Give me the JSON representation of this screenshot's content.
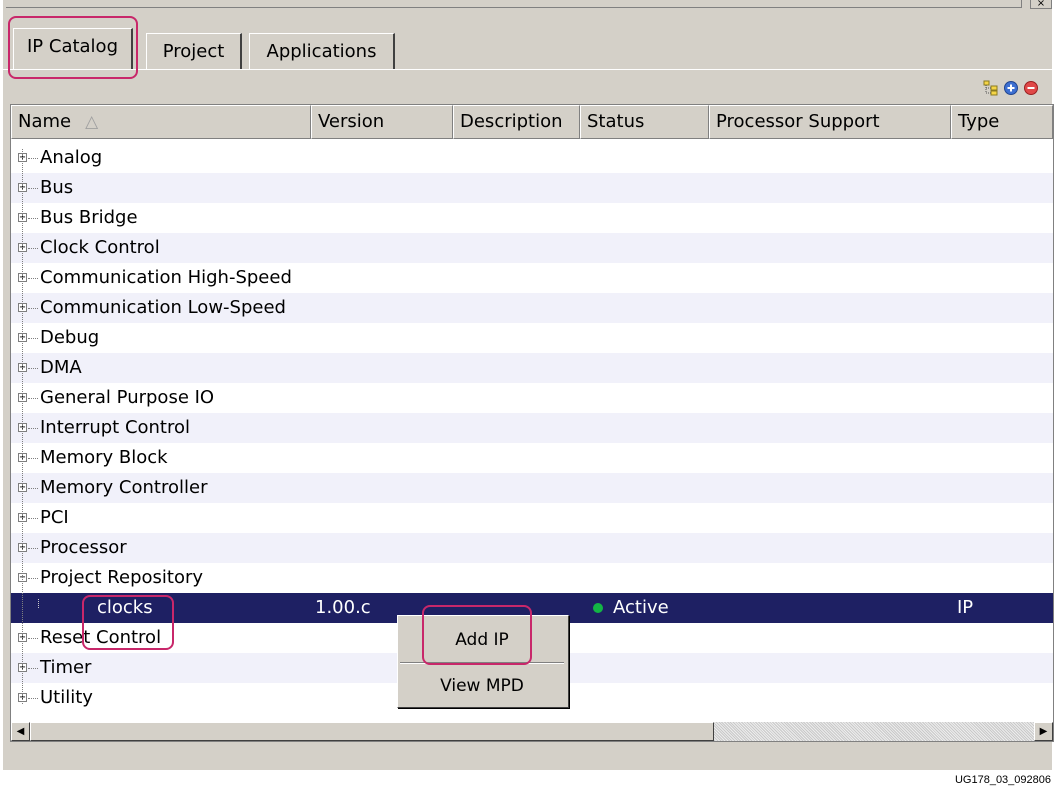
{
  "tabs": [
    {
      "label": "IP Catalog",
      "active": true
    },
    {
      "label": "Project",
      "active": false
    },
    {
      "label": "Applications",
      "active": false
    }
  ],
  "toolbar": {
    "icons": [
      "hierarchy-icon",
      "expand-all-icon",
      "collapse-all-icon"
    ]
  },
  "columns": [
    "Name",
    "Version",
    "Description",
    "Status",
    "Processor Support",
    "Type"
  ],
  "sort_indicator": "△",
  "rows": [
    {
      "name": "Analog",
      "expander": "+",
      "version": "",
      "status": "",
      "type": ""
    },
    {
      "name": "Bus",
      "expander": "+",
      "version": "",
      "status": "",
      "type": ""
    },
    {
      "name": "Bus Bridge",
      "expander": "+",
      "version": "",
      "status": "",
      "type": ""
    },
    {
      "name": "Clock Control",
      "expander": "+",
      "version": "",
      "status": "",
      "type": ""
    },
    {
      "name": "Communication High-Speed",
      "expander": "+",
      "version": "",
      "status": "",
      "type": ""
    },
    {
      "name": "Communication Low-Speed",
      "expander": "+",
      "version": "",
      "status": "",
      "type": ""
    },
    {
      "name": "Debug",
      "expander": "+",
      "version": "",
      "status": "",
      "type": ""
    },
    {
      "name": "DMA",
      "expander": "+",
      "version": "",
      "status": "",
      "type": ""
    },
    {
      "name": "General Purpose IO",
      "expander": "+",
      "version": "",
      "status": "",
      "type": ""
    },
    {
      "name": "Interrupt Control",
      "expander": "+",
      "version": "",
      "status": "",
      "type": ""
    },
    {
      "name": "Memory Block",
      "expander": "+",
      "version": "",
      "status": "",
      "type": ""
    },
    {
      "name": "Memory Controller",
      "expander": "+",
      "version": "",
      "status": "",
      "type": ""
    },
    {
      "name": "PCI",
      "expander": "+",
      "version": "",
      "status": "",
      "type": ""
    },
    {
      "name": "Processor",
      "expander": "+",
      "version": "",
      "status": "",
      "type": ""
    },
    {
      "name": "Project Repository",
      "expander": "−",
      "version": "",
      "status": "",
      "type": ""
    },
    {
      "name": "clocks",
      "expander": "",
      "version": "1.00.c",
      "status": "Active",
      "type": "IP",
      "selected": true
    },
    {
      "name": "Reset Control",
      "expander": "+",
      "version": "",
      "status": "",
      "type": ""
    },
    {
      "name": "Timer",
      "expander": "+",
      "version": "",
      "status": "",
      "type": ""
    },
    {
      "name": "Utility",
      "expander": "+",
      "version": "",
      "status": "",
      "type": ""
    }
  ],
  "context_menu": {
    "items": [
      "Add IP",
      "View MPD"
    ]
  },
  "scrollbar": {
    "left_arrow": "◀",
    "right_arrow": "▶"
  },
  "caption": "UG178_03_092806",
  "colors": {
    "selection": "#1e2063",
    "highlight": "#c8276a",
    "status_active": "#13b545",
    "chrome": "#d4d0c8"
  }
}
